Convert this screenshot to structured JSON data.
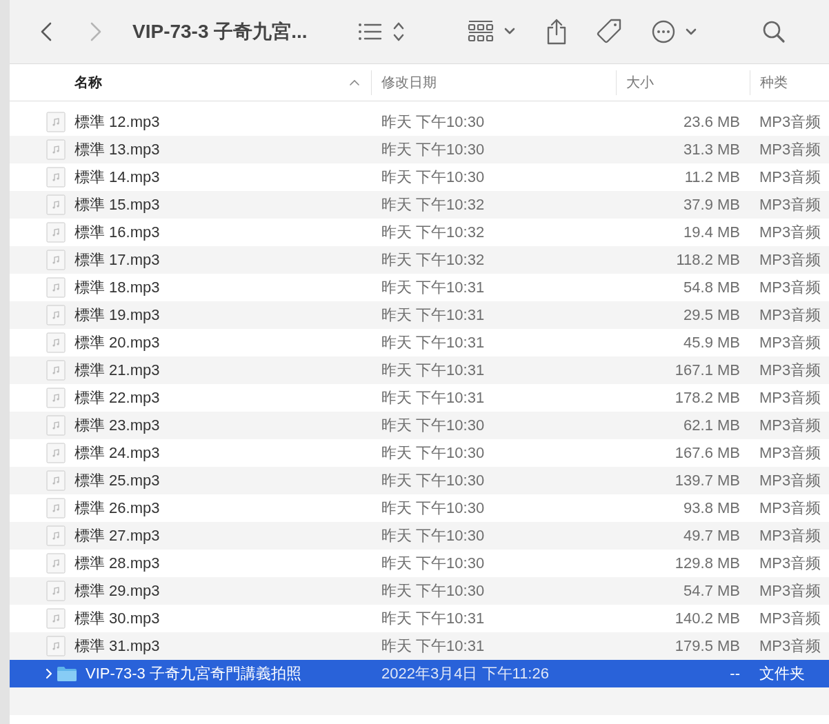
{
  "toolbar": {
    "nav": [
      {
        "kind": "back",
        "disabled": false
      },
      {
        "kind": "forward",
        "disabled": true
      }
    ],
    "title": "VIP-73-3 子奇九宮..."
  },
  "columns": [
    {
      "label": "名称",
      "sorted": true
    },
    {
      "label": "修改日期",
      "sorted": false
    },
    {
      "label": "大小",
      "sorted": false
    },
    {
      "label": "种类",
      "sorted": false
    }
  ],
  "rows": [
    {
      "kind": "file",
      "name": "標準 12.mp3",
      "date": "昨天 下午10:30",
      "size": "23.6 MB",
      "type": "MP3音频",
      "selected": false
    },
    {
      "kind": "file",
      "name": "標準 13.mp3",
      "date": "昨天 下午10:30",
      "size": "31.3 MB",
      "type": "MP3音频",
      "selected": false
    },
    {
      "kind": "file",
      "name": "標準 14.mp3",
      "date": "昨天 下午10:30",
      "size": "11.2 MB",
      "type": "MP3音频",
      "selected": false
    },
    {
      "kind": "file",
      "name": "標準 15.mp3",
      "date": "昨天 下午10:32",
      "size": "37.9 MB",
      "type": "MP3音频",
      "selected": false
    },
    {
      "kind": "file",
      "name": "標準 16.mp3",
      "date": "昨天 下午10:32",
      "size": "19.4 MB",
      "type": "MP3音频",
      "selected": false
    },
    {
      "kind": "file",
      "name": "標準 17.mp3",
      "date": "昨天 下午10:32",
      "size": "118.2 MB",
      "type": "MP3音频",
      "selected": false
    },
    {
      "kind": "file",
      "name": "標準 18.mp3",
      "date": "昨天 下午10:31",
      "size": "54.8 MB",
      "type": "MP3音频",
      "selected": false
    },
    {
      "kind": "file",
      "name": "標準 19.mp3",
      "date": "昨天 下午10:31",
      "size": "29.5 MB",
      "type": "MP3音频",
      "selected": false
    },
    {
      "kind": "file",
      "name": "標準 20.mp3",
      "date": "昨天 下午10:31",
      "size": "45.9 MB",
      "type": "MP3音频",
      "selected": false
    },
    {
      "kind": "file",
      "name": "標準 21.mp3",
      "date": "昨天 下午10:31",
      "size": "167.1 MB",
      "type": "MP3音频",
      "selected": false
    },
    {
      "kind": "file",
      "name": "標準 22.mp3",
      "date": "昨天 下午10:31",
      "size": "178.2 MB",
      "type": "MP3音频",
      "selected": false
    },
    {
      "kind": "file",
      "name": "標準 23.mp3",
      "date": "昨天 下午10:30",
      "size": "62.1 MB",
      "type": "MP3音频",
      "selected": false
    },
    {
      "kind": "file",
      "name": "標準 24.mp3",
      "date": "昨天 下午10:30",
      "size": "167.6 MB",
      "type": "MP3音频",
      "selected": false
    },
    {
      "kind": "file",
      "name": "標準 25.mp3",
      "date": "昨天 下午10:30",
      "size": "139.7 MB",
      "type": "MP3音频",
      "selected": false
    },
    {
      "kind": "file",
      "name": "標準 26.mp3",
      "date": "昨天 下午10:30",
      "size": "93.8 MB",
      "type": "MP3音频",
      "selected": false
    },
    {
      "kind": "file",
      "name": "標準 27.mp3",
      "date": "昨天 下午10:30",
      "size": "49.7 MB",
      "type": "MP3音频",
      "selected": false
    },
    {
      "kind": "file",
      "name": "標準 28.mp3",
      "date": "昨天 下午10:30",
      "size": "129.8 MB",
      "type": "MP3音频",
      "selected": false
    },
    {
      "kind": "file",
      "name": "標準 29.mp3",
      "date": "昨天 下午10:30",
      "size": "54.7 MB",
      "type": "MP3音频",
      "selected": false
    },
    {
      "kind": "file",
      "name": "標準 30.mp3",
      "date": "昨天 下午10:31",
      "size": "140.2 MB",
      "type": "MP3音频",
      "selected": false
    },
    {
      "kind": "file",
      "name": "標準 31.mp3",
      "date": "昨天 下午10:31",
      "size": "179.5 MB",
      "type": "MP3音频",
      "selected": false
    },
    {
      "kind": "folder",
      "name": "VIP-73-3 子奇九宮奇門講義拍照",
      "date": "2022年3月4日 下午11:26",
      "size": "--",
      "type": "文件夹",
      "selected": true,
      "expanded": false
    }
  ]
}
